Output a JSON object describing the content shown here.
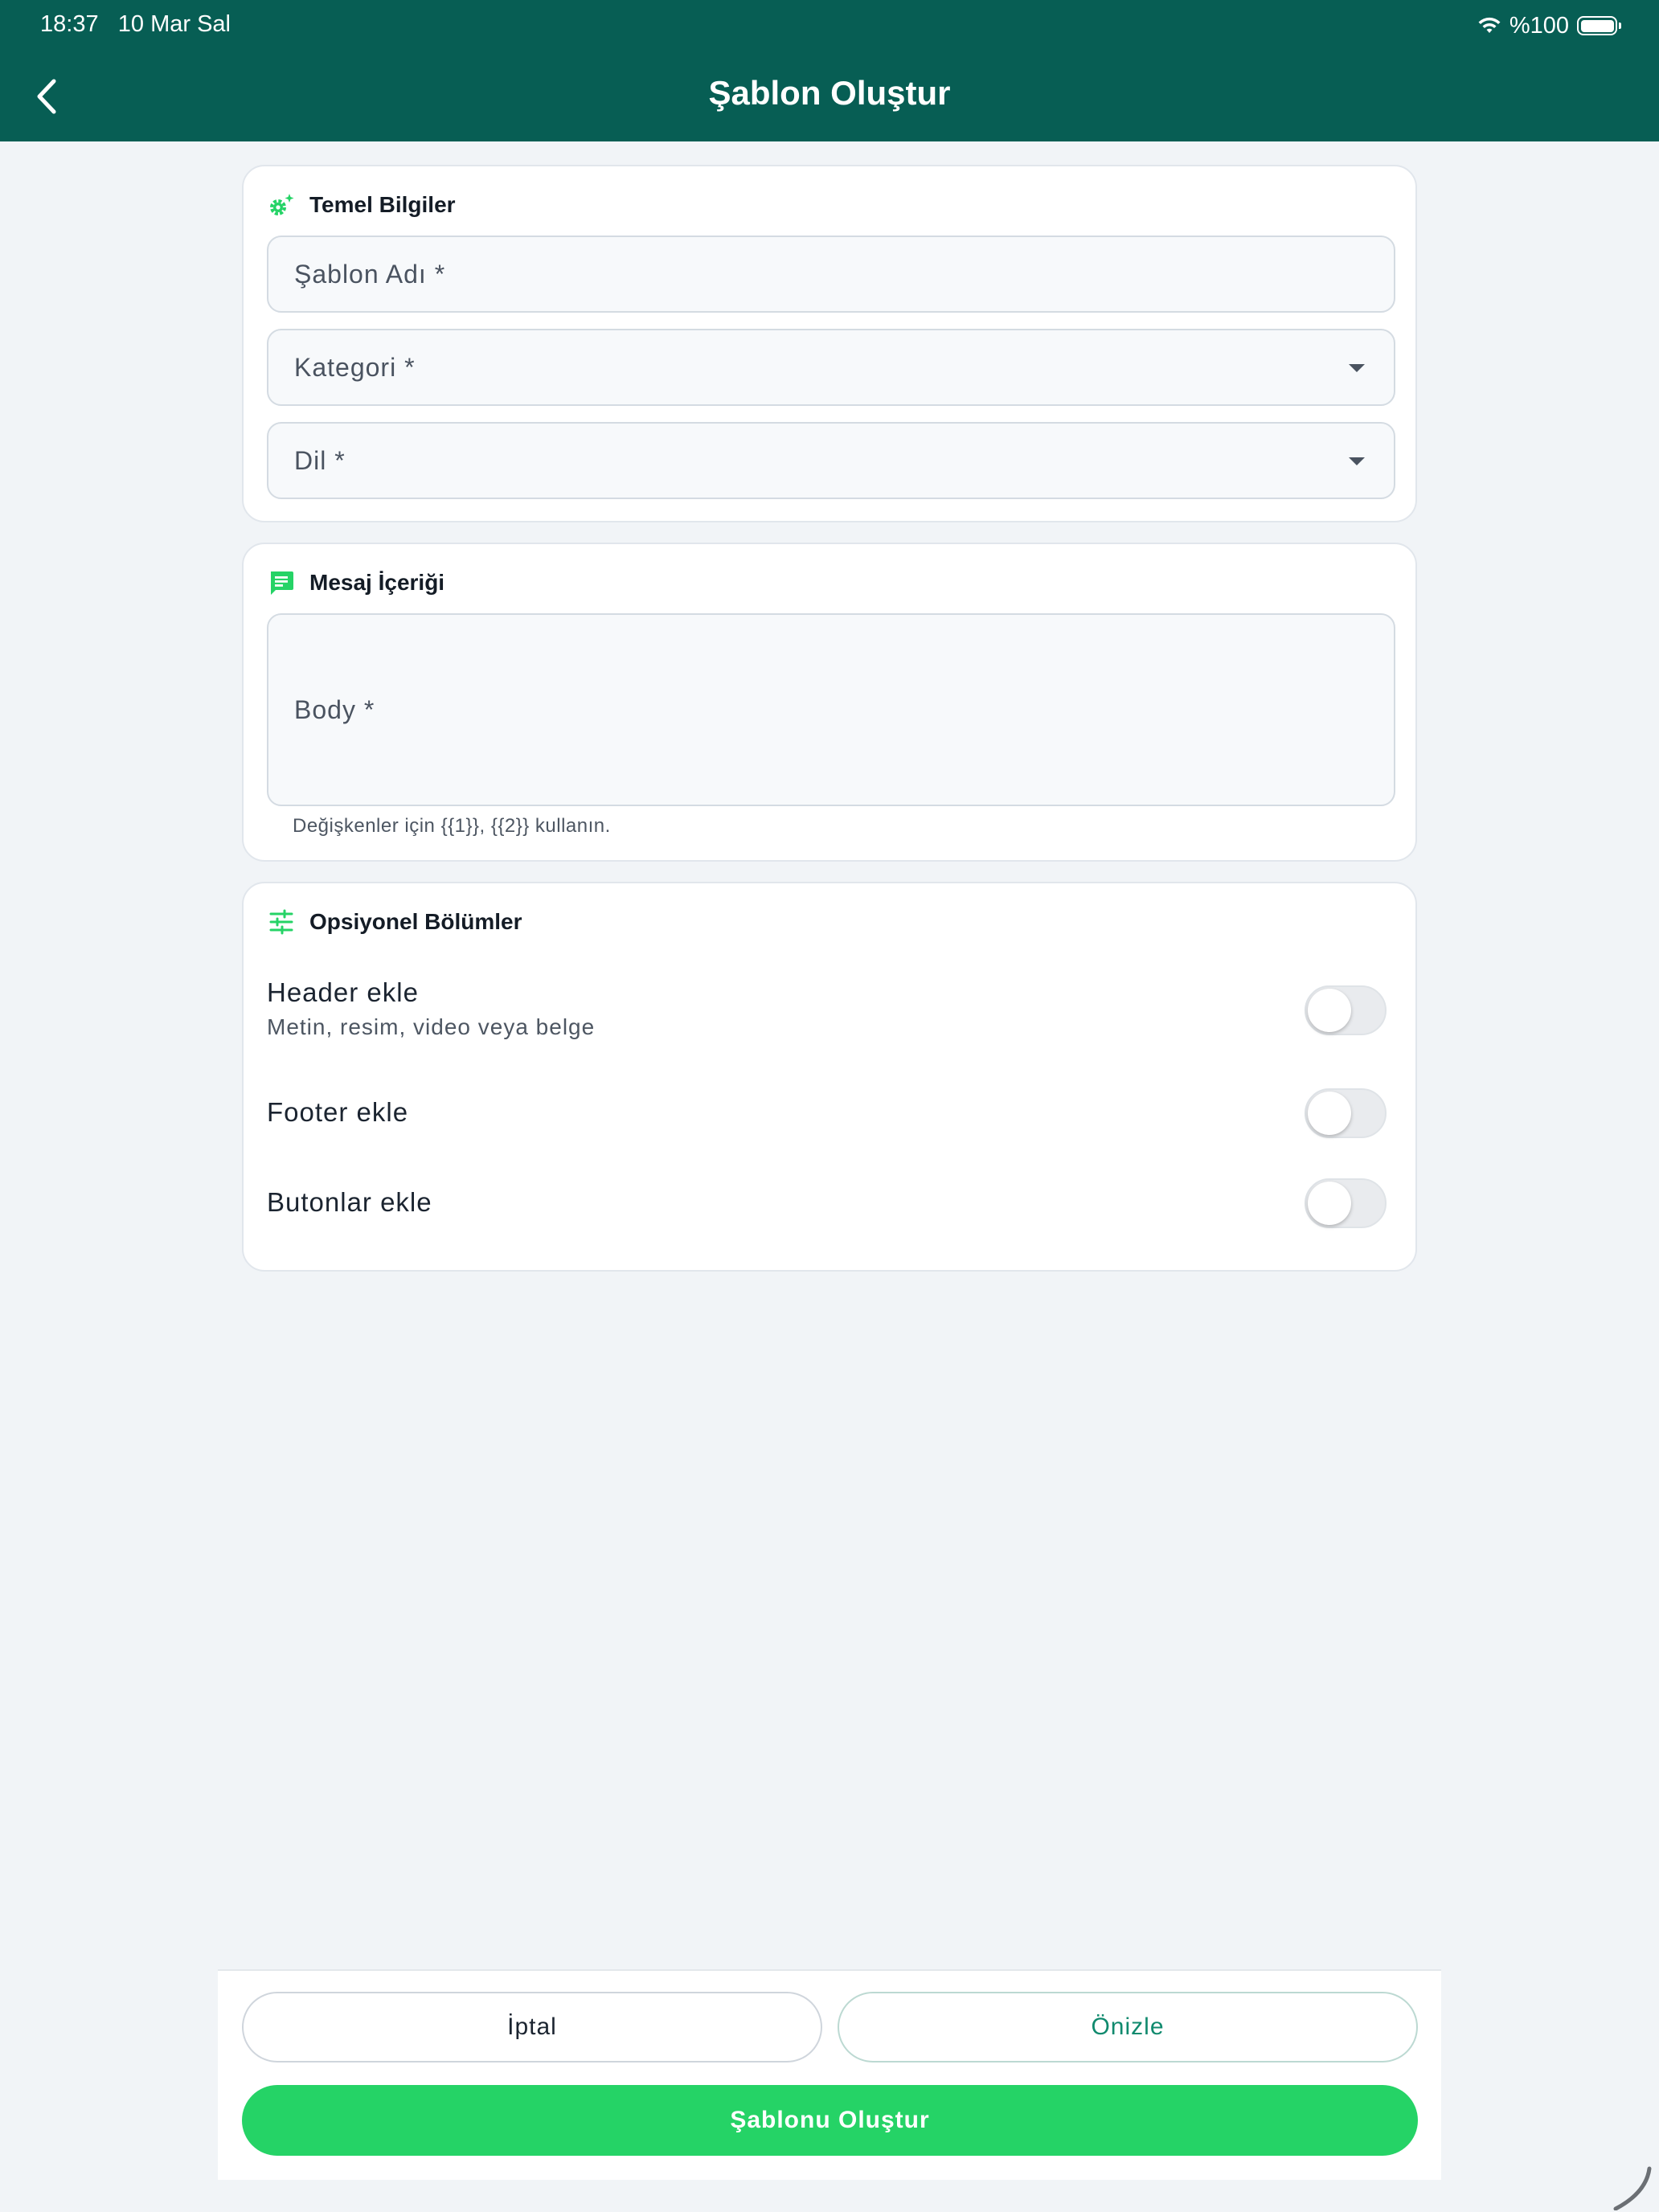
{
  "status_bar": {
    "time": "18:37",
    "date": "10 Mar Sal",
    "battery": "%100"
  },
  "header": {
    "title": "Şablon Oluştur",
    "back_icon": "chevron-left-icon"
  },
  "basic_info": {
    "title": "Temel Bilgiler",
    "icon": "gear-sparkle-icon",
    "template_name_placeholder": "Şablon Adı *",
    "category_placeholder": "Kategori *",
    "language_placeholder": "Dil *"
  },
  "message_content": {
    "title": "Mesaj İçeriği",
    "icon": "chat-message-icon",
    "body_placeholder": "Body *",
    "helper": "Değişkenler için {{1}}, {{2}} kullanın."
  },
  "optional_sections": {
    "title": "Opsiyonel Bölümler",
    "icon": "tune-sliders-icon",
    "items": [
      {
        "label": "Header ekle",
        "sublabel": "Metin, resim, video veya belge",
        "enabled": false
      },
      {
        "label": "Footer ekle",
        "enabled": false
      },
      {
        "label": "Butonlar ekle",
        "enabled": false
      }
    ]
  },
  "actions": {
    "cancel": "İptal",
    "preview": "Önizle",
    "create": "Şablonu Oluştur"
  },
  "colors": {
    "header_bg": "#075e54",
    "accent_green": "#25d366",
    "page_bg": "#f1f4f7"
  }
}
